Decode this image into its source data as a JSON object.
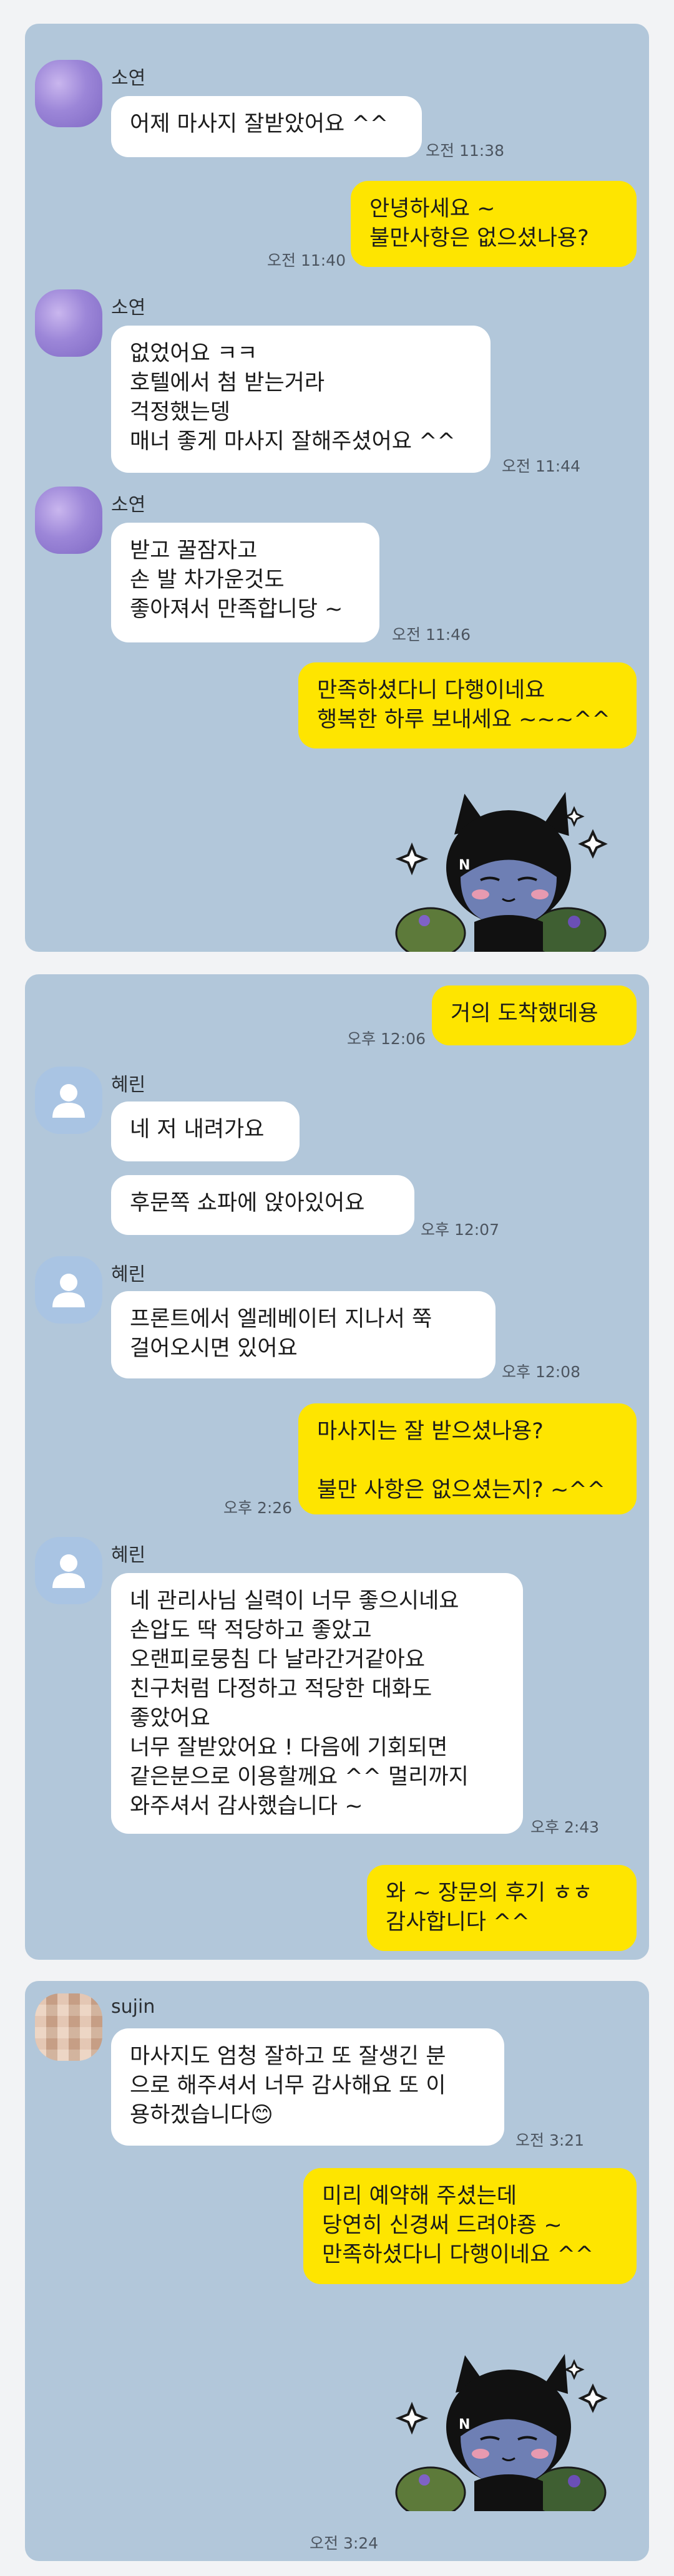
{
  "chats": [
    {
      "messages": [
        {
          "sender": "소연",
          "text": "어제 마사지 잘받았어요 ^^",
          "time": "오전 11:38"
        },
        {
          "text": "안녕하세요 ~\n불만사항은 없으셨나용?",
          "time": "오전 11:40"
        },
        {
          "sender": "소연",
          "text": "없었어요 ㅋㅋ\n호텔에서 첨 받는거라\n걱정했는뎅\n매너 좋게 마사지 잘해주셨어요 ^^",
          "time": "오전 11:44"
        },
        {
          "sender": "소연",
          "text": "받고 꿀잠자고\n손 발 차가운것도\n좋아져서 만족합니당 ~",
          "time": "오전 11:46"
        },
        {
          "text": "만족하셨다니 다행이네요\n행복한 하루 보내세요 ~~~^^"
        }
      ]
    },
    {
      "messages": [
        {
          "text": "거의 도착했데용",
          "time": "오후 12:06"
        },
        {
          "sender": "혜린",
          "text": "네 저 내려가요"
        },
        {
          "text": "후문쪽 쇼파에 앉아있어요",
          "time": "오후 12:07"
        },
        {
          "sender": "혜린",
          "text": "프론트에서 엘레베이터 지나서 쭉\n걸어오시면 있어요",
          "time": "오후 12:08"
        },
        {
          "text": "마사지는 잘 받으셨나용?\n\n불만 사항은 없으셨는지? ~^^",
          "time": "오후 2:26"
        },
        {
          "sender": "혜린",
          "text": "네 관리사님 실력이 너무 좋으시네요\n손압도 딱 적당하고 좋았고\n오랜피로뭉침 다 날라간거같아요\n친구처럼 다정하고 적당한 대화도\n좋았어요\n너무 잘받았어요 ! 다음에 기회되면\n같은분으로 이용할께요 ^^ 멀리까지\n와주셔서 감사했습니다 ~",
          "time": "오후 2:43"
        },
        {
          "text": "와 ~ 장문의 후기 ㅎㅎ\n감사합니다 ^^"
        }
      ]
    },
    {
      "messages": [
        {
          "sender": "sujin",
          "text": "마사지도 엄청 잘하고 또 잘생긴 분\n으로 해주셔서 너무 감사해요 또 이\n용하겠습니다😊",
          "time": "오전 3:21"
        },
        {
          "text": "미리 예약해 주셨는데\n당연히 신경써 드려야죵 ~\n만족하셨다니 다행이네요 ^^",
          "time": "오전 3:24"
        }
      ]
    }
  ],
  "colors": {
    "page_bg": "#f2f3f5",
    "chat_bg": "#b2c7da",
    "incoming": "#ffffff",
    "outgoing": "#fee500"
  },
  "icons": {
    "avatar_default": "person-icon",
    "sticker": "black-cat-character-sticker"
  }
}
